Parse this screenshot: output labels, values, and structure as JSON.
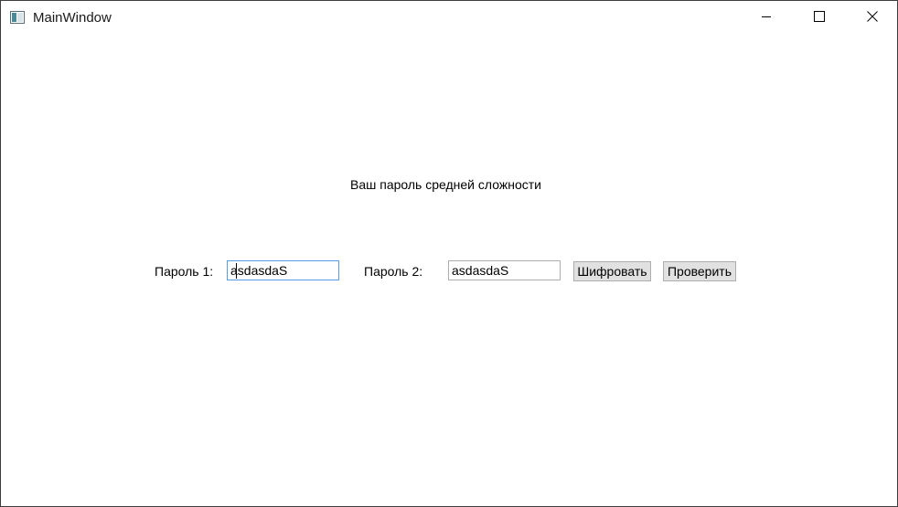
{
  "window": {
    "title": "MainWindow",
    "app_icon": "window-app-icon",
    "controls": {
      "minimize": "minimize-icon",
      "maximize": "maximize-icon",
      "close": "close-icon"
    }
  },
  "main": {
    "status_text": "Ваш пароль средней сложности",
    "password1": {
      "label": "Пароль 1:",
      "value": "asdasdaS"
    },
    "password2": {
      "label": "Пароль 2:",
      "value": "asdasdaS"
    },
    "encrypt_button": "Шифровать",
    "check_button": "Проверить"
  },
  "colors": {
    "focused_border": "#569de5",
    "button_face": "#e1e1e1",
    "button_border": "#adadad"
  }
}
